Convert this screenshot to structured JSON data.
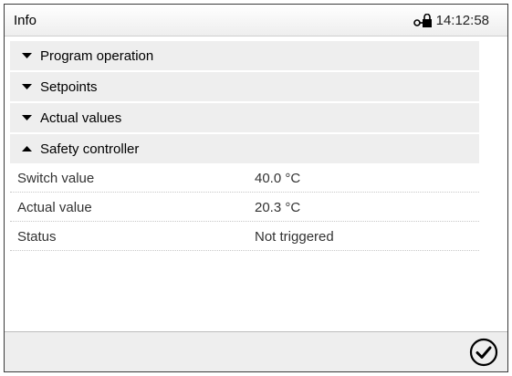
{
  "header": {
    "title": "Info",
    "time": "14:12:58",
    "lock_icon": "lock-key-icon"
  },
  "sections": [
    {
      "label": "Program operation",
      "expanded": false
    },
    {
      "label": "Setpoints",
      "expanded": false
    },
    {
      "label": "Actual values",
      "expanded": false
    },
    {
      "label": "Safety controller",
      "expanded": true
    }
  ],
  "safety_controller": {
    "rows": [
      {
        "label": "Switch value",
        "value": "40.0 °C"
      },
      {
        "label": "Actual value",
        "value": "20.3 °C"
      },
      {
        "label": "Status",
        "value": "Not triggered"
      }
    ]
  },
  "footer": {
    "confirm_icon": "checkmark-circle-icon"
  }
}
